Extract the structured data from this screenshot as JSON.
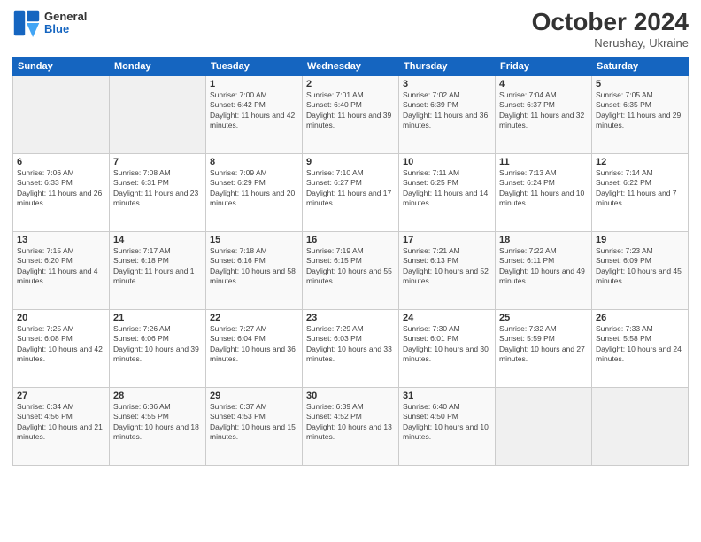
{
  "header": {
    "logo": {
      "line1": "General",
      "line2": "Blue"
    },
    "month_year": "October 2024",
    "location": "Nerushay, Ukraine"
  },
  "weekdays": [
    "Sunday",
    "Monday",
    "Tuesday",
    "Wednesday",
    "Thursday",
    "Friday",
    "Saturday"
  ],
  "weeks": [
    [
      {
        "day": "",
        "sunrise": "",
        "sunset": "",
        "daylight": ""
      },
      {
        "day": "",
        "sunrise": "",
        "sunset": "",
        "daylight": ""
      },
      {
        "day": "1",
        "sunrise": "Sunrise: 7:00 AM",
        "sunset": "Sunset: 6:42 PM",
        "daylight": "Daylight: 11 hours and 42 minutes."
      },
      {
        "day": "2",
        "sunrise": "Sunrise: 7:01 AM",
        "sunset": "Sunset: 6:40 PM",
        "daylight": "Daylight: 11 hours and 39 minutes."
      },
      {
        "day": "3",
        "sunrise": "Sunrise: 7:02 AM",
        "sunset": "Sunset: 6:39 PM",
        "daylight": "Daylight: 11 hours and 36 minutes."
      },
      {
        "day": "4",
        "sunrise": "Sunrise: 7:04 AM",
        "sunset": "Sunset: 6:37 PM",
        "daylight": "Daylight: 11 hours and 32 minutes."
      },
      {
        "day": "5",
        "sunrise": "Sunrise: 7:05 AM",
        "sunset": "Sunset: 6:35 PM",
        "daylight": "Daylight: 11 hours and 29 minutes."
      }
    ],
    [
      {
        "day": "6",
        "sunrise": "Sunrise: 7:06 AM",
        "sunset": "Sunset: 6:33 PM",
        "daylight": "Daylight: 11 hours and 26 minutes."
      },
      {
        "day": "7",
        "sunrise": "Sunrise: 7:08 AM",
        "sunset": "Sunset: 6:31 PM",
        "daylight": "Daylight: 11 hours and 23 minutes."
      },
      {
        "day": "8",
        "sunrise": "Sunrise: 7:09 AM",
        "sunset": "Sunset: 6:29 PM",
        "daylight": "Daylight: 11 hours and 20 minutes."
      },
      {
        "day": "9",
        "sunrise": "Sunrise: 7:10 AM",
        "sunset": "Sunset: 6:27 PM",
        "daylight": "Daylight: 11 hours and 17 minutes."
      },
      {
        "day": "10",
        "sunrise": "Sunrise: 7:11 AM",
        "sunset": "Sunset: 6:25 PM",
        "daylight": "Daylight: 11 hours and 14 minutes."
      },
      {
        "day": "11",
        "sunrise": "Sunrise: 7:13 AM",
        "sunset": "Sunset: 6:24 PM",
        "daylight": "Daylight: 11 hours and 10 minutes."
      },
      {
        "day": "12",
        "sunrise": "Sunrise: 7:14 AM",
        "sunset": "Sunset: 6:22 PM",
        "daylight": "Daylight: 11 hours and 7 minutes."
      }
    ],
    [
      {
        "day": "13",
        "sunrise": "Sunrise: 7:15 AM",
        "sunset": "Sunset: 6:20 PM",
        "daylight": "Daylight: 11 hours and 4 minutes."
      },
      {
        "day": "14",
        "sunrise": "Sunrise: 7:17 AM",
        "sunset": "Sunset: 6:18 PM",
        "daylight": "Daylight: 11 hours and 1 minute."
      },
      {
        "day": "15",
        "sunrise": "Sunrise: 7:18 AM",
        "sunset": "Sunset: 6:16 PM",
        "daylight": "Daylight: 10 hours and 58 minutes."
      },
      {
        "day": "16",
        "sunrise": "Sunrise: 7:19 AM",
        "sunset": "Sunset: 6:15 PM",
        "daylight": "Daylight: 10 hours and 55 minutes."
      },
      {
        "day": "17",
        "sunrise": "Sunrise: 7:21 AM",
        "sunset": "Sunset: 6:13 PM",
        "daylight": "Daylight: 10 hours and 52 minutes."
      },
      {
        "day": "18",
        "sunrise": "Sunrise: 7:22 AM",
        "sunset": "Sunset: 6:11 PM",
        "daylight": "Daylight: 10 hours and 49 minutes."
      },
      {
        "day": "19",
        "sunrise": "Sunrise: 7:23 AM",
        "sunset": "Sunset: 6:09 PM",
        "daylight": "Daylight: 10 hours and 45 minutes."
      }
    ],
    [
      {
        "day": "20",
        "sunrise": "Sunrise: 7:25 AM",
        "sunset": "Sunset: 6:08 PM",
        "daylight": "Daylight: 10 hours and 42 minutes."
      },
      {
        "day": "21",
        "sunrise": "Sunrise: 7:26 AM",
        "sunset": "Sunset: 6:06 PM",
        "daylight": "Daylight: 10 hours and 39 minutes."
      },
      {
        "day": "22",
        "sunrise": "Sunrise: 7:27 AM",
        "sunset": "Sunset: 6:04 PM",
        "daylight": "Daylight: 10 hours and 36 minutes."
      },
      {
        "day": "23",
        "sunrise": "Sunrise: 7:29 AM",
        "sunset": "Sunset: 6:03 PM",
        "daylight": "Daylight: 10 hours and 33 minutes."
      },
      {
        "day": "24",
        "sunrise": "Sunrise: 7:30 AM",
        "sunset": "Sunset: 6:01 PM",
        "daylight": "Daylight: 10 hours and 30 minutes."
      },
      {
        "day": "25",
        "sunrise": "Sunrise: 7:32 AM",
        "sunset": "Sunset: 5:59 PM",
        "daylight": "Daylight: 10 hours and 27 minutes."
      },
      {
        "day": "26",
        "sunrise": "Sunrise: 7:33 AM",
        "sunset": "Sunset: 5:58 PM",
        "daylight": "Daylight: 10 hours and 24 minutes."
      }
    ],
    [
      {
        "day": "27",
        "sunrise": "Sunrise: 6:34 AM",
        "sunset": "Sunset: 4:56 PM",
        "daylight": "Daylight: 10 hours and 21 minutes."
      },
      {
        "day": "28",
        "sunrise": "Sunrise: 6:36 AM",
        "sunset": "Sunset: 4:55 PM",
        "daylight": "Daylight: 10 hours and 18 minutes."
      },
      {
        "day": "29",
        "sunrise": "Sunrise: 6:37 AM",
        "sunset": "Sunset: 4:53 PM",
        "daylight": "Daylight: 10 hours and 15 minutes."
      },
      {
        "day": "30",
        "sunrise": "Sunrise: 6:39 AM",
        "sunset": "Sunset: 4:52 PM",
        "daylight": "Daylight: 10 hours and 13 minutes."
      },
      {
        "day": "31",
        "sunrise": "Sunrise: 6:40 AM",
        "sunset": "Sunset: 4:50 PM",
        "daylight": "Daylight: 10 hours and 10 minutes."
      },
      {
        "day": "",
        "sunrise": "",
        "sunset": "",
        "daylight": ""
      },
      {
        "day": "",
        "sunrise": "",
        "sunset": "",
        "daylight": ""
      }
    ]
  ]
}
